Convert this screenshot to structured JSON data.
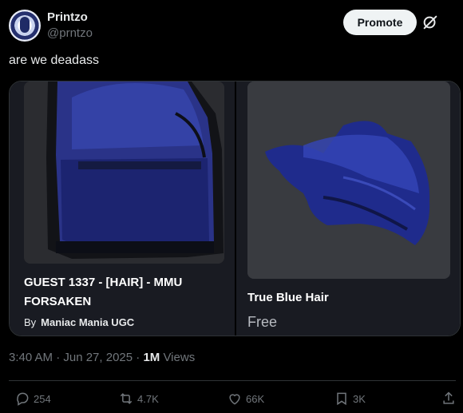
{
  "author": {
    "name": "Printzo",
    "handle": "@prntzo",
    "avatar_icon": "avatar-icon"
  },
  "header": {
    "promote_label": "Promote",
    "grok_icon": "grok-icon"
  },
  "tweet": {
    "text": "are we deadass"
  },
  "card": {
    "items": [
      {
        "title": "GUEST 1337 - [HAIR] - MMU FORSAKEN",
        "by_label": "By",
        "creator": "Maniac Mania UGC",
        "image_icon": "blue-hair-front-image"
      },
      {
        "title": "True Blue Hair",
        "price": "Free",
        "image_icon": "blue-hair-side-image"
      }
    ]
  },
  "meta": {
    "time_date": "3:40 AM · Jun 27, 2025 · ",
    "views_count": "1M",
    "views_label": " Views"
  },
  "actions": {
    "replies": "254",
    "reposts": "4.7K",
    "likes": "66K",
    "bookmarks": "3K"
  },
  "colors": {
    "background": "#000000",
    "text": "#e7e9ea",
    "muted": "#71767b",
    "card_panel": "#191b22"
  }
}
